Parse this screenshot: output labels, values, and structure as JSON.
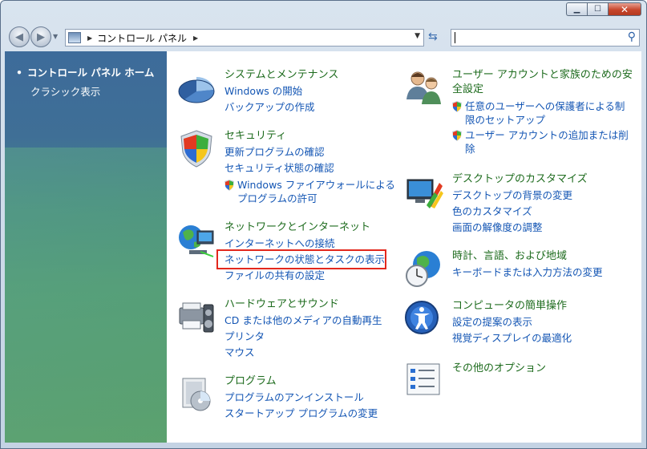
{
  "address": {
    "path": "コントロール パネル",
    "search_placeholder": ""
  },
  "sidebar": {
    "home_label": "コントロール パネル ホーム",
    "classic_label": "クラシック表示"
  },
  "categories": {
    "system": {
      "title": "システムとメンテナンス",
      "links": [
        "Windows の開始",
        "バックアップの作成"
      ]
    },
    "security": {
      "title": "セキュリティ",
      "links": [
        "更新プログラムの確認",
        "セキュリティ状態の確認"
      ],
      "sublinks": [
        "Windows ファイアウォールによる",
        "プログラムの許可"
      ]
    },
    "network": {
      "title": "ネットワークとインターネット",
      "links": [
        "インターネットへの接続",
        "ネットワークの状態とタスクの表示",
        "ファイルの共有の設定"
      ]
    },
    "hardware": {
      "title": "ハードウェアとサウンド",
      "links": [
        "CD または他のメディアの自動再生",
        "プリンタ",
        "マウス"
      ]
    },
    "programs": {
      "title": "プログラム",
      "links": [
        "プログラムのアンインストール",
        "スタートアップ プログラムの変更"
      ]
    },
    "users": {
      "title_line1": "ユーザー アカウントと家族のための安",
      "title_line2": "全設定",
      "sublink1_line1": "任意のユーザーへの保護者による制",
      "sublink1_line2": "限のセットアップ",
      "sublink2_line1": "ユーザー アカウントの追加または削",
      "sublink2_line2": "除"
    },
    "appearance": {
      "title": "デスクトップのカスタマイズ",
      "links": [
        "デスクトップの背景の変更",
        "色のカスタマイズ",
        "画面の解像度の調整"
      ]
    },
    "clock": {
      "title": "時計、言語、および地域",
      "links": [
        "キーボードまたは入力方法の変更"
      ]
    },
    "ease": {
      "title": "コンピュータの簡単操作",
      "links": [
        "設定の提案の表示",
        "視覚ディスプレイの最適化"
      ]
    },
    "other": {
      "title": "その他のオプション"
    }
  },
  "colors": {
    "link": "#1456b4",
    "category_title": "#1d6b1d",
    "highlight": "#e3281d"
  }
}
